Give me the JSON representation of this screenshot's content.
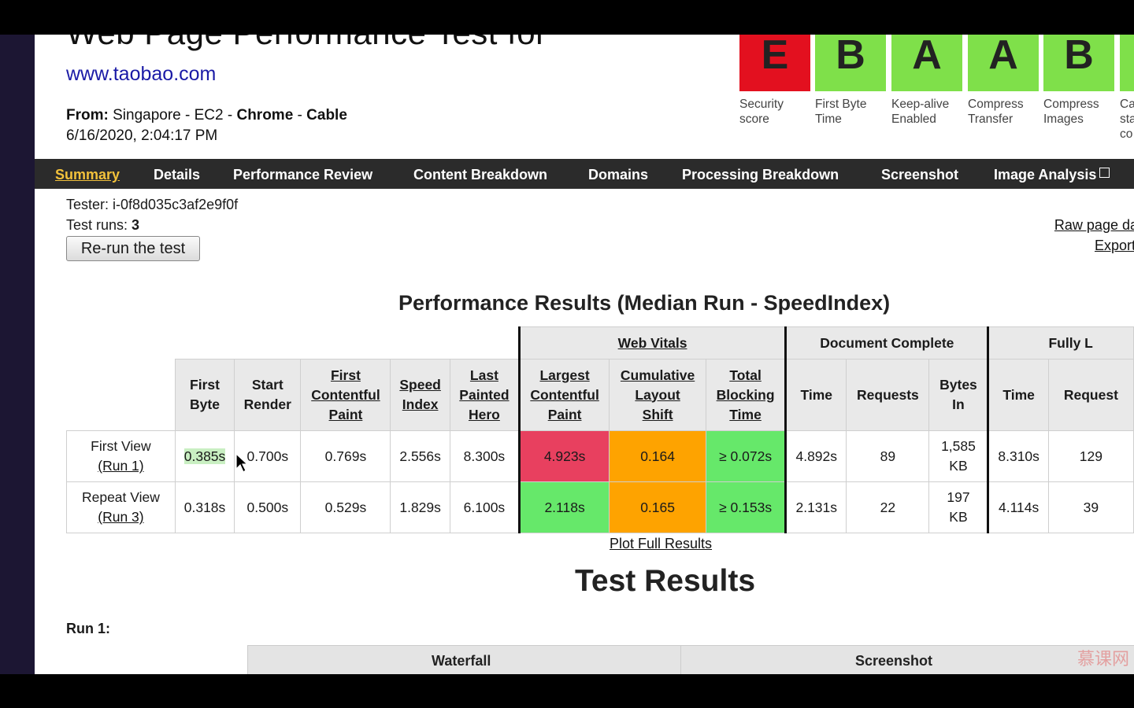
{
  "header": {
    "title": "Web Page Performance Test for",
    "url": "www.taobao.com",
    "from_label": "From:",
    "location": "Singapore - EC2 -",
    "browser": "Chrome",
    "sep": "-",
    "connection": "Cable",
    "date": "6/16/2020, 2:04:17 PM"
  },
  "grades": [
    {
      "letter": "E",
      "caption1": "Security",
      "caption2": "score",
      "color": "#e3101f"
    },
    {
      "letter": "B",
      "caption1": "First Byte",
      "caption2": "Time",
      "color": "#7fe04a"
    },
    {
      "letter": "A",
      "caption1": "Keep-alive",
      "caption2": "Enabled",
      "color": "#7fe04a"
    },
    {
      "letter": "A",
      "caption1": "Compress",
      "caption2": "Transfer",
      "color": "#7fe04a"
    },
    {
      "letter": "B",
      "caption1": "Compress",
      "caption2": "Images",
      "color": "#7fe04a"
    },
    {
      "letter": "",
      "caption1": "Ca",
      "caption2": "sta",
      "caption3": "co",
      "color": "#7fe04a"
    }
  ],
  "nav": {
    "summary": "Summary",
    "details": "Details",
    "performance_review": "Performance Review",
    "content_breakdown": "Content Breakdown",
    "domains": "Domains",
    "processing_breakdown": "Processing Breakdown",
    "screenshot": "Screenshot",
    "image_analysis": "Image Analysis"
  },
  "info": {
    "tester_label": "Tester: i-0f8d035c3af2e9f0f",
    "runs_label": "Test runs: ",
    "runs_value": "3",
    "rerun_button": "Re-run the test",
    "raw_page_data": "Raw page data",
    "export": "Export H"
  },
  "results": {
    "title": "Performance Results (Median Run - SpeedIndex)",
    "groups": {
      "web_vitals": "Web Vitals",
      "document_complete": "Document Complete",
      "fully_loaded": "Fully L"
    },
    "columns": {
      "first_byte": [
        "First",
        "Byte"
      ],
      "start_render": [
        "Start",
        "Render"
      ],
      "fcp": [
        "First",
        "Contentful",
        "Paint"
      ],
      "speed_index": [
        "Speed",
        "Index"
      ],
      "lph": [
        "Last",
        "Painted",
        "Hero"
      ],
      "lcp": [
        "Largest",
        "Contentful",
        "Paint"
      ],
      "cls": [
        "Cumulative",
        "Layout",
        "Shift"
      ],
      "tbt": [
        "Total",
        "Blocking",
        "Time"
      ],
      "dc_time": "Time",
      "dc_requests": "Requests",
      "dc_bytes": [
        "Bytes",
        "In"
      ],
      "fl_time": "Time",
      "fl_requests": "Request"
    },
    "rows": [
      {
        "label": "First View",
        "run": "(Run 1)",
        "first_byte": "0.385s",
        "start_render": "0.700s",
        "fcp": "0.769s",
        "speed_index": "2.556s",
        "lph": "8.300s",
        "lcp": "4.923s",
        "cls": "0.164",
        "tbt": "≥ 0.072s",
        "dc_time": "4.892s",
        "dc_requests": "89",
        "dc_bytes1": "1,585",
        "dc_bytes2": "KB",
        "fl_time": "8.310s",
        "fl_requests": "129"
      },
      {
        "label": "Repeat View",
        "run": "(Run 3)",
        "first_byte": "0.318s",
        "start_render": "0.500s",
        "fcp": "0.529s",
        "speed_index": "1.829s",
        "lph": "6.100s",
        "lcp": "2.118s",
        "cls": "0.165",
        "tbt": "≥ 0.153s",
        "dc_time": "2.131s",
        "dc_requests": "22",
        "dc_bytes1": "197",
        "dc_bytes2": "KB",
        "fl_time": "4.114s",
        "fl_requests": "39"
      }
    ],
    "plot_link": "Plot Full Results"
  },
  "test_results": {
    "title": "Test Results",
    "run_label": "Run 1:",
    "waterfall": "Waterfall",
    "screenshot": "Screenshot"
  },
  "watermark": "慕课网",
  "colors": {
    "red": "#e8405f",
    "orange": "#fea300",
    "green": "#66e86a",
    "nav_bg": "#2b2b2b",
    "nav_active": "#f2c13b"
  }
}
